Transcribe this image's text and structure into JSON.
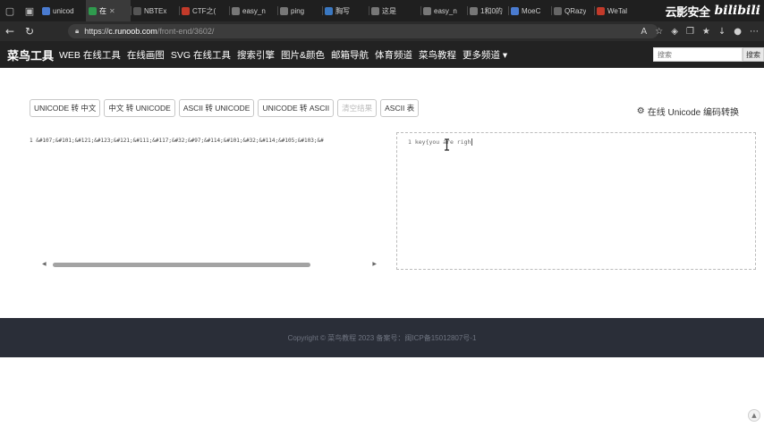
{
  "browser": {
    "tabs": [
      {
        "title": "unicod",
        "color": "#4a7bd0",
        "active": false
      },
      {
        "title": "在",
        "color": "#2f9b4e",
        "active": true
      },
      {
        "title": "NBTEx",
        "color": "#555555",
        "active": false
      },
      {
        "title": "CTF之(",
        "color": "#c23a2a",
        "active": false
      },
      {
        "title": "easy_n",
        "color": "#777777",
        "active": false
      },
      {
        "title": "ping",
        "color": "#777777",
        "active": false
      },
      {
        "title": "胸写",
        "color": "#3a78c2",
        "active": false
      },
      {
        "title": "这是",
        "color": "#777777",
        "active": false
      },
      {
        "title": "easy_n",
        "color": "#777777",
        "active": false
      },
      {
        "title": "1和0的",
        "color": "#777777",
        "active": false
      },
      {
        "title": "MoeC",
        "color": "#4a7bd0",
        "active": false
      },
      {
        "title": "QRazy",
        "color": "#666666",
        "active": false
      },
      {
        "title": "WeTal",
        "color": "#c23a2a",
        "active": false
      }
    ],
    "url_scheme": "https://",
    "url_host": "c.runoob.com",
    "url_path": "/front-end/3602/",
    "watermark_text": "云影安全",
    "watermark_brand": "bilibili"
  },
  "site": {
    "logo": "菜鸟工具",
    "nav": [
      "WEB 在线工具",
      "在线画图",
      "SVG 在线工具",
      "搜索引擎",
      "图片&颜色",
      "邮箱导航",
      "体育频道",
      "菜鸟教程",
      "更多频道 ▾"
    ],
    "search_placeholder": "搜索",
    "search_button": "搜索"
  },
  "tool": {
    "buttons": [
      {
        "label": "UNICODE 转 中文",
        "faded": false
      },
      {
        "label": "中文 转 UNICODE",
        "faded": false
      },
      {
        "label": "ASCII 转 UNICODE",
        "faded": false
      },
      {
        "label": "UNICODE 转 ASCII",
        "faded": false
      },
      {
        "label": "清空结果",
        "faded": true
      },
      {
        "label": "ASCII 表",
        "faded": false
      }
    ],
    "title": "在线 Unicode 编码转换",
    "input_text": "1 &#107;&#101;&#121;&#123;&#121;&#111;&#117;&#32;&#97;&#114;&#101;&#32;&#114;&#105;&#103;&#",
    "output_text": "1 key{you are righ"
  },
  "footer": {
    "copyright": "Copyright © 菜鸟教程 2023 备案号：闽ICP备15012807号-1"
  },
  "colors": {
    "tabstrip": "#1f1f1f",
    "addrbar": "#2b2b2b",
    "sitenav": "#222222",
    "footer": "#2a2e38"
  }
}
